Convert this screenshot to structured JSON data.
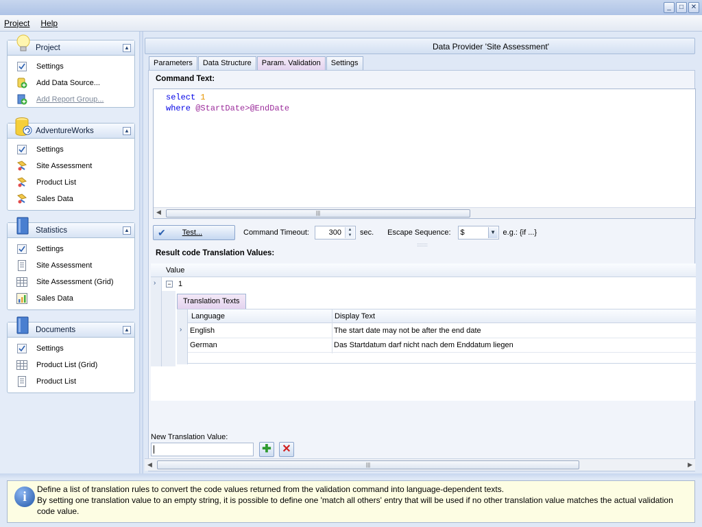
{
  "menu": {
    "project": "Project",
    "help": "Help"
  },
  "window_buttons": [
    "_",
    "□",
    "✕"
  ],
  "groups": [
    {
      "title": "Project",
      "icon": "lightbulb-icon",
      "items": [
        {
          "label": "Settings",
          "icon": "settings-checklist-icon",
          "link": false
        },
        {
          "label": "Add Data Source...",
          "icon": "add-data-source-icon",
          "link": false
        },
        {
          "label": "Add Report Group...",
          "icon": "add-report-group-icon",
          "link": true
        }
      ]
    },
    {
      "title": "AdventureWorks",
      "icon": "database-icon",
      "items": [
        {
          "label": "Settings",
          "icon": "settings-checklist-icon",
          "link": false
        },
        {
          "label": "Site Assessment",
          "icon": "data-provider-icon",
          "link": false
        },
        {
          "label": "Product List",
          "icon": "data-provider-icon",
          "link": false
        },
        {
          "label": "Sales Data",
          "icon": "data-provider-icon",
          "link": false
        }
      ]
    },
    {
      "title": "Statistics",
      "icon": "book-icon",
      "items": [
        {
          "label": "Settings",
          "icon": "settings-checklist-icon",
          "link": false
        },
        {
          "label": "Site Assessment",
          "icon": "document-icon",
          "link": false
        },
        {
          "label": "Site Assessment (Grid)",
          "icon": "grid-icon",
          "link": false
        },
        {
          "label": "Sales Data",
          "icon": "chart-icon",
          "link": false
        }
      ]
    },
    {
      "title": "Documents",
      "icon": "book-icon",
      "items": [
        {
          "label": "Settings",
          "icon": "settings-checklist-icon",
          "link": false
        },
        {
          "label": "Product List (Grid)",
          "icon": "grid-icon",
          "link": false
        },
        {
          "label": "Product List",
          "icon": "document-icon",
          "link": false
        }
      ]
    }
  ],
  "main": {
    "header": "Data Provider 'Site Assessment'",
    "tabs": [
      "Parameters",
      "Data Structure",
      "Param. Validation",
      "Settings"
    ],
    "active_tab": "Param. Validation",
    "command_text_label": "Command Text:",
    "code": {
      "line1_keyword": "select",
      "line1_number": "1",
      "line2_keyword": "where",
      "line2_param1": "@StartDate",
      "line2_operator": ">",
      "line2_param2": "@EndDate"
    },
    "test_button": "Test...",
    "command_timeout_label": "Command Timeout:",
    "command_timeout_value": "300",
    "sec_label": "sec.",
    "escape_sequence_label": "Escape Sequence:",
    "escape_sequence_value": "$",
    "example_label": "e.g.: {if ...}",
    "result_label": "Result code Translation Values:",
    "grid": {
      "column": "Value",
      "rows": [
        {
          "value": "1",
          "detail_tab": "Translation Texts",
          "detail_columns": [
            "Language",
            "Display Text"
          ],
          "detail_rows": [
            {
              "language": "English",
              "text": "The start date may not be after the end date"
            },
            {
              "language": "German",
              "text": "Das Startdatum darf nicht nach dem Enddatum liegen"
            }
          ]
        }
      ]
    },
    "new_value_label": "New Translation Value:",
    "new_value_input": ""
  },
  "info": {
    "line1": "Define a list of translation rules to convert the code values returned from the validation command into language-dependent texts.",
    "line2": "By setting one translation value to an empty string, it is possible to define one 'match all others' entry that will be used if no other translation value matches the actual validation code value."
  }
}
